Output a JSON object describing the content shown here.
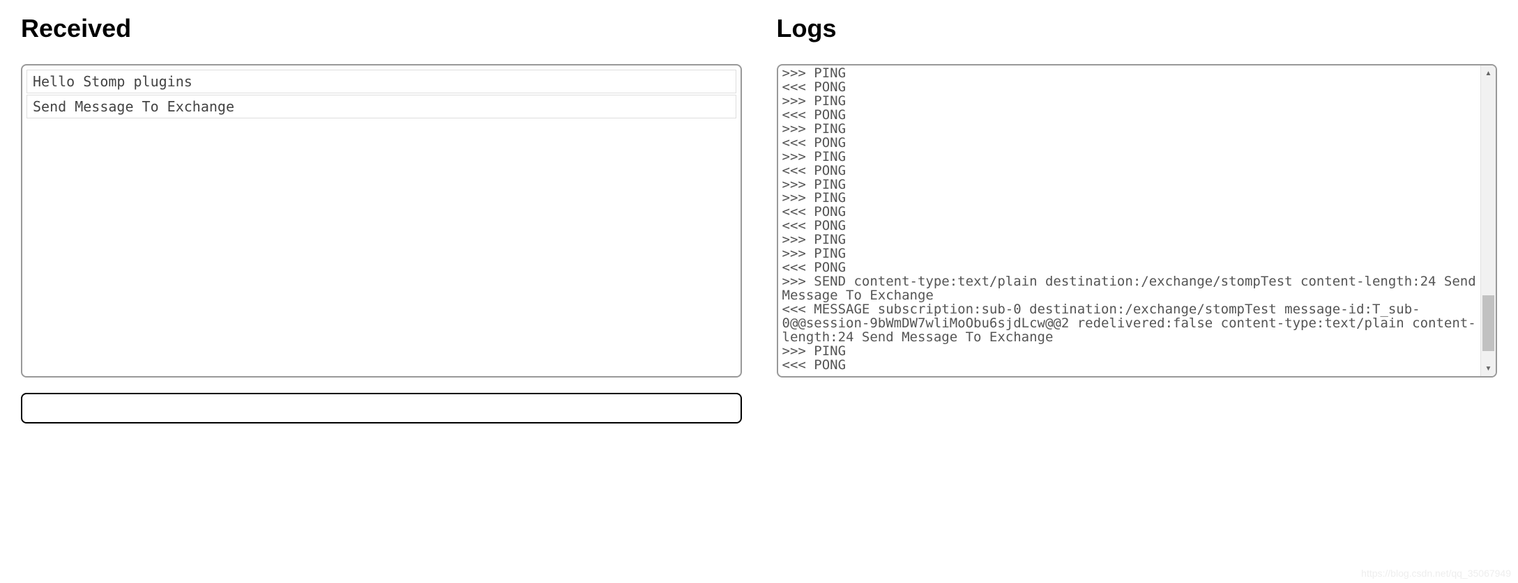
{
  "left": {
    "heading": "Received",
    "items": [
      "Hello Stomp plugins",
      "Send Message To Exchange"
    ],
    "input_value": ""
  },
  "right": {
    "heading": "Logs",
    "lines": [
      ">>> PING",
      "<<< PONG",
      ">>> PING",
      "<<< PONG",
      ">>> PING",
      "<<< PONG",
      ">>> PING",
      "<<< PONG",
      ">>> PING",
      ">>> PING",
      "<<< PONG",
      "<<< PONG",
      ">>> PING",
      ">>> PING",
      "<<< PONG",
      ">>> SEND content-type:text/plain destination:/exchange/stompTest content-length:24 Send Message To Exchange",
      "<<< MESSAGE subscription:sub-0 destination:/exchange/stompTest message-id:T_sub-0@@session-9bWmDW7wliMoObu6sjdLcw@@2 redelivered:false content-type:text/plain content-length:24 Send Message To Exchange",
      ">>> PING",
      "<<< PONG"
    ],
    "scroll_thumb": {
      "top_pct": 74,
      "height_pct": 18
    }
  },
  "watermark": "https://blog.csdn.net/qq_35067949"
}
